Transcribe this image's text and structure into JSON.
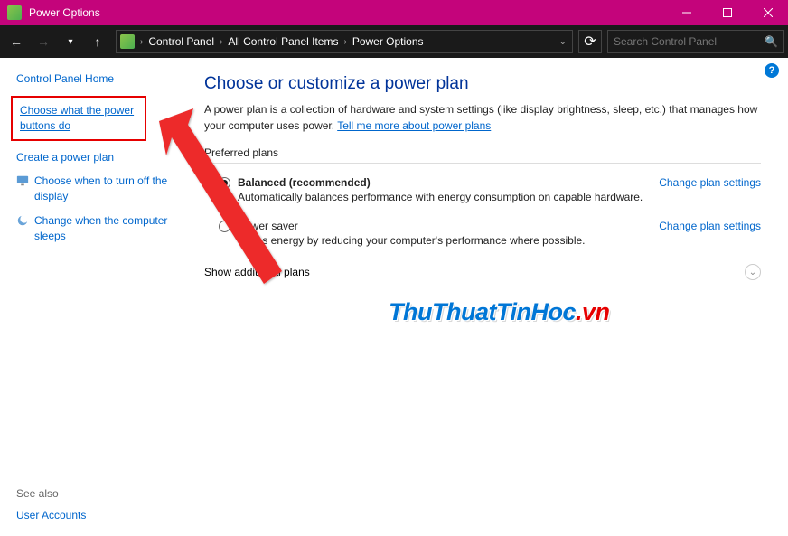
{
  "titlebar": {
    "title": "Power Options"
  },
  "breadcrumb": {
    "segments": [
      "Control Panel",
      "All Control Panel Items",
      "Power Options"
    ]
  },
  "search": {
    "placeholder": "Search Control Panel"
  },
  "sidebar": {
    "home": "Control Panel Home",
    "links": {
      "choose_buttons": "Choose what the power buttons do",
      "create_plan": "Create a power plan",
      "turn_off_display": "Choose when to turn off the display",
      "computer_sleeps": "Change when the computer sleeps"
    },
    "see_also": "See also",
    "user_accounts": "User Accounts"
  },
  "main": {
    "heading": "Choose or customize a power plan",
    "desc_pre": "A power plan is a collection of hardware and system settings (like display brightness, sleep, etc.) that manages how your computer uses power. ",
    "desc_link": "Tell me more about power plans",
    "preferred": "Preferred plans",
    "plans": [
      {
        "name": "Balanced (recommended)",
        "desc": "Automatically balances performance with energy consumption on capable hardware.",
        "link": "Change plan settings"
      },
      {
        "name": "Power saver",
        "desc": "Saves energy by reducing your computer's performance where possible.",
        "link": "Change plan settings"
      }
    ],
    "show_additional": "Show additional plans"
  },
  "watermark": {
    "part1": "ThuThuatTinHoc",
    "part2": ".vn"
  }
}
